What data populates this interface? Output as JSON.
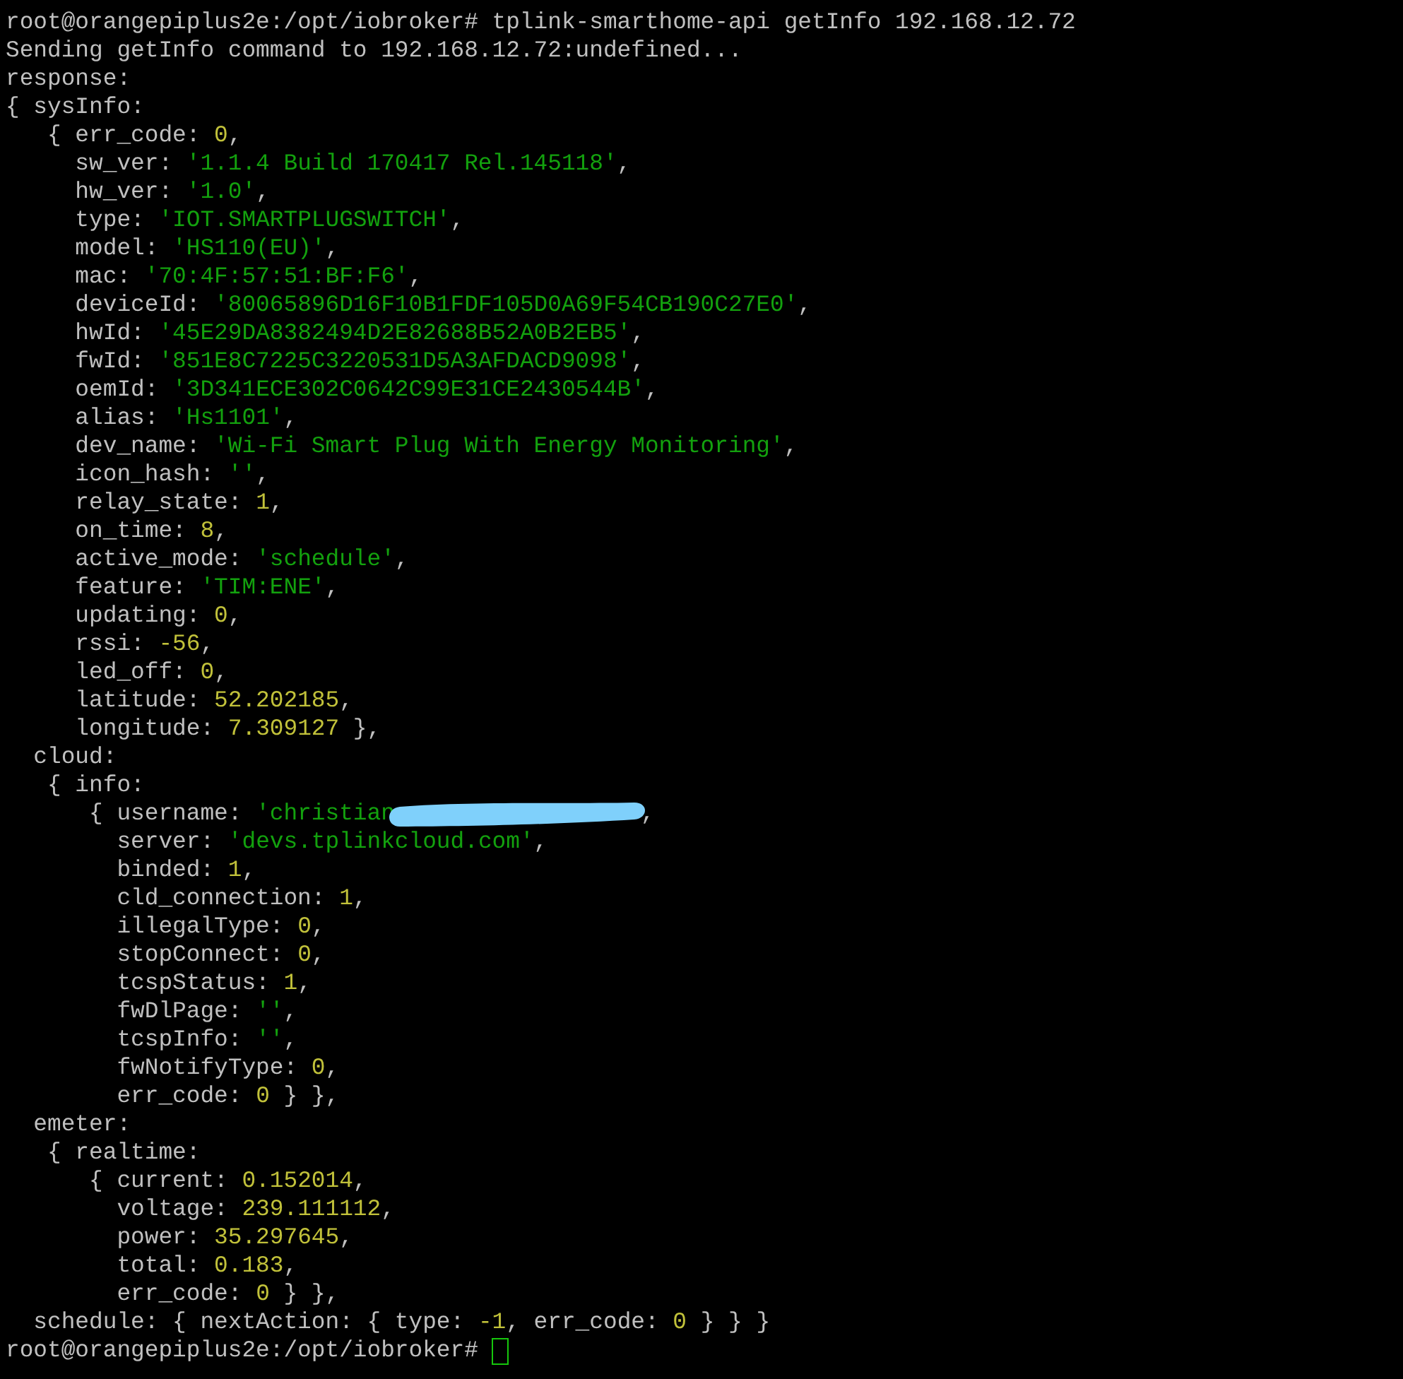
{
  "terminal": {
    "lines": [
      {
        "segments": [
          {
            "kind": "plain",
            "text": "root@orangepiplus2e:/opt/iobroker# tplink-smarthome-api getInfo 192.168.12.72"
          }
        ]
      },
      {
        "segments": [
          {
            "kind": "plain",
            "text": "Sending getInfo command to 192.168.12.72:undefined..."
          }
        ]
      },
      {
        "segments": [
          {
            "kind": "plain",
            "text": "response:"
          }
        ]
      },
      {
        "segments": [
          {
            "kind": "plain",
            "text": "{ sysInfo:"
          }
        ]
      },
      {
        "segments": [
          {
            "kind": "plain",
            "text": "   { err_code: "
          },
          {
            "kind": "number",
            "text": "0"
          },
          {
            "kind": "plain",
            "text": ","
          }
        ]
      },
      {
        "segments": [
          {
            "kind": "plain",
            "text": "     sw_ver: "
          },
          {
            "kind": "string",
            "text": "'1.1.4 Build 170417 Rel.145118'"
          },
          {
            "kind": "plain",
            "text": ","
          }
        ]
      },
      {
        "segments": [
          {
            "kind": "plain",
            "text": "     hw_ver: "
          },
          {
            "kind": "string",
            "text": "'1.0'"
          },
          {
            "kind": "plain",
            "text": ","
          }
        ]
      },
      {
        "segments": [
          {
            "kind": "plain",
            "text": "     type: "
          },
          {
            "kind": "string",
            "text": "'IOT.SMARTPLUGSWITCH'"
          },
          {
            "kind": "plain",
            "text": ","
          }
        ]
      },
      {
        "segments": [
          {
            "kind": "plain",
            "text": "     model: "
          },
          {
            "kind": "string",
            "text": "'HS110(EU)'"
          },
          {
            "kind": "plain",
            "text": ","
          }
        ]
      },
      {
        "segments": [
          {
            "kind": "plain",
            "text": "     mac: "
          },
          {
            "kind": "string",
            "text": "'70:4F:57:51:BF:F6'"
          },
          {
            "kind": "plain",
            "text": ","
          }
        ]
      },
      {
        "segments": [
          {
            "kind": "plain",
            "text": "     deviceId: "
          },
          {
            "kind": "string",
            "text": "'80065896D16F10B1FDF105D0A69F54CB190C27E0'"
          },
          {
            "kind": "plain",
            "text": ","
          }
        ]
      },
      {
        "segments": [
          {
            "kind": "plain",
            "text": "     hwId: "
          },
          {
            "kind": "string",
            "text": "'45E29DA8382494D2E82688B52A0B2EB5'"
          },
          {
            "kind": "plain",
            "text": ","
          }
        ]
      },
      {
        "segments": [
          {
            "kind": "plain",
            "text": "     fwId: "
          },
          {
            "kind": "string",
            "text": "'851E8C7225C3220531D5A3AFDACD9098'"
          },
          {
            "kind": "plain",
            "text": ","
          }
        ]
      },
      {
        "segments": [
          {
            "kind": "plain",
            "text": "     oemId: "
          },
          {
            "kind": "string",
            "text": "'3D341ECE302C0642C99E31CE2430544B'"
          },
          {
            "kind": "plain",
            "text": ","
          }
        ]
      },
      {
        "segments": [
          {
            "kind": "plain",
            "text": "     alias: "
          },
          {
            "kind": "string",
            "text": "'Hs1101'"
          },
          {
            "kind": "plain",
            "text": ","
          }
        ]
      },
      {
        "segments": [
          {
            "kind": "plain",
            "text": "     dev_name: "
          },
          {
            "kind": "string",
            "text": "'Wi-Fi Smart Plug With Energy Monitoring'"
          },
          {
            "kind": "plain",
            "text": ","
          }
        ]
      },
      {
        "segments": [
          {
            "kind": "plain",
            "text": "     icon_hash: "
          },
          {
            "kind": "string",
            "text": "''"
          },
          {
            "kind": "plain",
            "text": ","
          }
        ]
      },
      {
        "segments": [
          {
            "kind": "plain",
            "text": "     relay_state: "
          },
          {
            "kind": "number",
            "text": "1"
          },
          {
            "kind": "plain",
            "text": ","
          }
        ]
      },
      {
        "segments": [
          {
            "kind": "plain",
            "text": "     on_time: "
          },
          {
            "kind": "number",
            "text": "8"
          },
          {
            "kind": "plain",
            "text": ","
          }
        ]
      },
      {
        "segments": [
          {
            "kind": "plain",
            "text": "     active_mode: "
          },
          {
            "kind": "string",
            "text": "'schedule'"
          },
          {
            "kind": "plain",
            "text": ","
          }
        ]
      },
      {
        "segments": [
          {
            "kind": "plain",
            "text": "     feature: "
          },
          {
            "kind": "string",
            "text": "'TIM:ENE'"
          },
          {
            "kind": "plain",
            "text": ","
          }
        ]
      },
      {
        "segments": [
          {
            "kind": "plain",
            "text": "     updating: "
          },
          {
            "kind": "number",
            "text": "0"
          },
          {
            "kind": "plain",
            "text": ","
          }
        ]
      },
      {
        "segments": [
          {
            "kind": "plain",
            "text": "     rssi: "
          },
          {
            "kind": "number",
            "text": "-56"
          },
          {
            "kind": "plain",
            "text": ","
          }
        ]
      },
      {
        "segments": [
          {
            "kind": "plain",
            "text": "     led_off: "
          },
          {
            "kind": "number",
            "text": "0"
          },
          {
            "kind": "plain",
            "text": ","
          }
        ]
      },
      {
        "segments": [
          {
            "kind": "plain",
            "text": "     latitude: "
          },
          {
            "kind": "number",
            "text": "52.202185"
          },
          {
            "kind": "plain",
            "text": ","
          }
        ]
      },
      {
        "segments": [
          {
            "kind": "plain",
            "text": "     longitude: "
          },
          {
            "kind": "number",
            "text": "7.309127"
          },
          {
            "kind": "plain",
            "text": " },"
          }
        ]
      },
      {
        "segments": [
          {
            "kind": "plain",
            "text": "  cloud:"
          }
        ]
      },
      {
        "segments": [
          {
            "kind": "plain",
            "text": "   { info:"
          }
        ]
      },
      {
        "segments": [
          {
            "kind": "plain",
            "text": "      { username: "
          },
          {
            "kind": "string",
            "text": "'christian"
          },
          {
            "kind": "redaction"
          },
          {
            "kind": "plain",
            "text": ","
          }
        ]
      },
      {
        "segments": [
          {
            "kind": "plain",
            "text": "        server: "
          },
          {
            "kind": "string",
            "text": "'devs.tplinkcloud.com'"
          },
          {
            "kind": "plain",
            "text": ","
          }
        ]
      },
      {
        "segments": [
          {
            "kind": "plain",
            "text": "        binded: "
          },
          {
            "kind": "number",
            "text": "1"
          },
          {
            "kind": "plain",
            "text": ","
          }
        ]
      },
      {
        "segments": [
          {
            "kind": "plain",
            "text": "        cld_connection: "
          },
          {
            "kind": "number",
            "text": "1"
          },
          {
            "kind": "plain",
            "text": ","
          }
        ]
      },
      {
        "segments": [
          {
            "kind": "plain",
            "text": "        illegalType: "
          },
          {
            "kind": "number",
            "text": "0"
          },
          {
            "kind": "plain",
            "text": ","
          }
        ]
      },
      {
        "segments": [
          {
            "kind": "plain",
            "text": "        stopConnect: "
          },
          {
            "kind": "number",
            "text": "0"
          },
          {
            "kind": "plain",
            "text": ","
          }
        ]
      },
      {
        "segments": [
          {
            "kind": "plain",
            "text": "        tcspStatus: "
          },
          {
            "kind": "number",
            "text": "1"
          },
          {
            "kind": "plain",
            "text": ","
          }
        ]
      },
      {
        "segments": [
          {
            "kind": "plain",
            "text": "        fwDlPage: "
          },
          {
            "kind": "string",
            "text": "''"
          },
          {
            "kind": "plain",
            "text": ","
          }
        ]
      },
      {
        "segments": [
          {
            "kind": "plain",
            "text": "        tcspInfo: "
          },
          {
            "kind": "string",
            "text": "''"
          },
          {
            "kind": "plain",
            "text": ","
          }
        ]
      },
      {
        "segments": [
          {
            "kind": "plain",
            "text": "        fwNotifyType: "
          },
          {
            "kind": "number",
            "text": "0"
          },
          {
            "kind": "plain",
            "text": ","
          }
        ]
      },
      {
        "segments": [
          {
            "kind": "plain",
            "text": "        err_code: "
          },
          {
            "kind": "number",
            "text": "0"
          },
          {
            "kind": "plain",
            "text": " } },"
          }
        ]
      },
      {
        "segments": [
          {
            "kind": "plain",
            "text": "  emeter:"
          }
        ]
      },
      {
        "segments": [
          {
            "kind": "plain",
            "text": "   { realtime:"
          }
        ]
      },
      {
        "segments": [
          {
            "kind": "plain",
            "text": "      { current: "
          },
          {
            "kind": "number",
            "text": "0.152014"
          },
          {
            "kind": "plain",
            "text": ","
          }
        ]
      },
      {
        "segments": [
          {
            "kind": "plain",
            "text": "        voltage: "
          },
          {
            "kind": "number",
            "text": "239.111112"
          },
          {
            "kind": "plain",
            "text": ","
          }
        ]
      },
      {
        "segments": [
          {
            "kind": "plain",
            "text": "        power: "
          },
          {
            "kind": "number",
            "text": "35.297645"
          },
          {
            "kind": "plain",
            "text": ","
          }
        ]
      },
      {
        "segments": [
          {
            "kind": "plain",
            "text": "        total: "
          },
          {
            "kind": "number",
            "text": "0.183"
          },
          {
            "kind": "plain",
            "text": ","
          }
        ]
      },
      {
        "segments": [
          {
            "kind": "plain",
            "text": "        err_code: "
          },
          {
            "kind": "number",
            "text": "0"
          },
          {
            "kind": "plain",
            "text": " } },"
          }
        ]
      },
      {
        "segments": [
          {
            "kind": "plain",
            "text": "  schedule: { nextAction: { type: "
          },
          {
            "kind": "number",
            "text": "-1"
          },
          {
            "kind": "plain",
            "text": ", err_code: "
          },
          {
            "kind": "number",
            "text": "0"
          },
          {
            "kind": "plain",
            "text": " } } }"
          }
        ]
      },
      {
        "segments": [
          {
            "kind": "plain",
            "text": "root@orangepiplus2e:/opt/iobroker# "
          },
          {
            "kind": "cursor"
          }
        ]
      }
    ]
  }
}
